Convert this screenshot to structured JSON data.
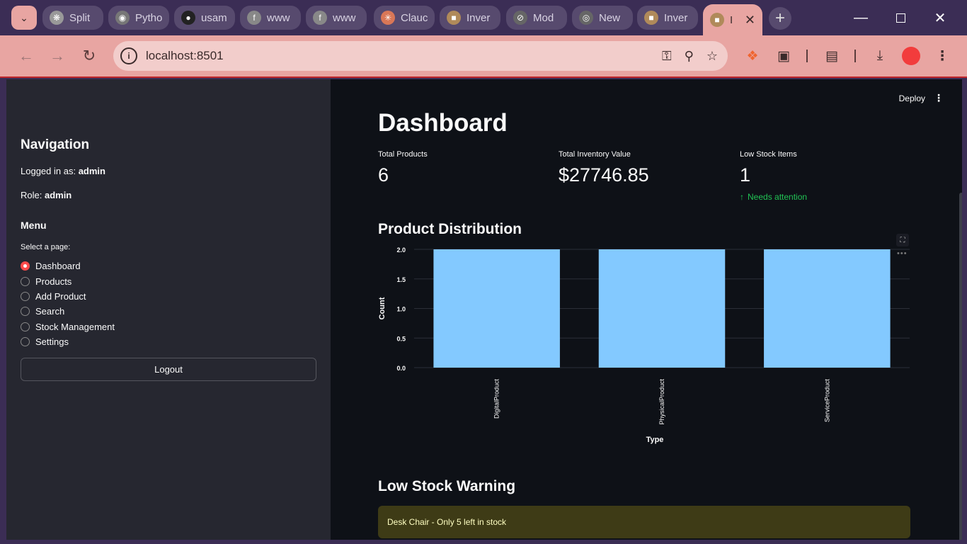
{
  "browser": {
    "tabs": [
      {
        "label": "Split",
        "icon": "openai-icon"
      },
      {
        "label": "Pytho",
        "icon": "globe-icon"
      },
      {
        "label": "usam",
        "icon": "github-icon"
      },
      {
        "label": "www",
        "icon": "fi-icon"
      },
      {
        "label": "www",
        "icon": "fi-icon"
      },
      {
        "label": "Clauc",
        "icon": "claude-icon"
      },
      {
        "label": "Inver",
        "icon": "box-icon"
      },
      {
        "label": "Mod",
        "icon": "slash-icon"
      },
      {
        "label": "New",
        "icon": "chrome-icon"
      },
      {
        "label": "Inver",
        "icon": "box-icon"
      },
      {
        "label": "I",
        "icon": "box-icon"
      }
    ],
    "url": "localhost:8501"
  },
  "sidebar": {
    "title": "Navigation",
    "logged_in_label": "Logged in as: ",
    "username": "admin",
    "role_label": "Role: ",
    "role": "admin",
    "menu_title": "Menu",
    "select_label": "Select a page:",
    "pages": [
      "Dashboard",
      "Products",
      "Add Product",
      "Search",
      "Stock Management",
      "Settings"
    ],
    "selected": "Dashboard",
    "logout_label": "Logout"
  },
  "main": {
    "deploy_label": "Deploy",
    "title": "Dashboard",
    "metrics": [
      {
        "label": "Total Products",
        "value": "6"
      },
      {
        "label": "Total Inventory Value",
        "value": "$27746.85"
      },
      {
        "label": "Low Stock Items",
        "value": "1",
        "delta": "Needs attention"
      }
    ],
    "distribution_title": "Product Distribution",
    "low_stock_title": "Low Stock Warning",
    "warning_text": "Desk Chair - Only 5 left in stock"
  },
  "colors": {
    "accent": "#ff4b4b",
    "bar": "#83c9ff",
    "positive": "#21c354"
  },
  "chart_data": {
    "type": "bar",
    "categories": [
      "DigitalProduct",
      "PhysicalProduct",
      "ServiceProduct"
    ],
    "values": [
      2,
      2,
      2
    ],
    "xlabel": "Type",
    "ylabel": "Count",
    "ylim": [
      0,
      2
    ],
    "yticks": [
      "0.0",
      "0.5",
      "1.0",
      "1.5",
      "2.0"
    ],
    "grid": true
  }
}
